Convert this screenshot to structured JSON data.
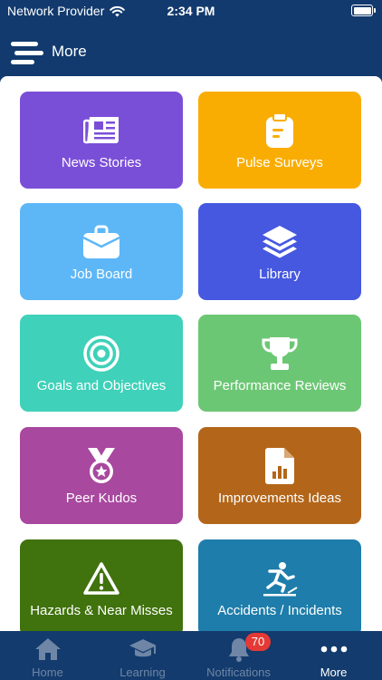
{
  "status_bar": {
    "carrier": "Network Provider",
    "time": "2:34 PM"
  },
  "header": {
    "title": "More"
  },
  "colors": {
    "app_bar": "#123a6e",
    "content_background": "#ffffff",
    "badge": "#e53935"
  },
  "tiles": [
    {
      "label": "News Stories",
      "icon": "newspaper-icon",
      "color": "#7a4fd8"
    },
    {
      "label": "Pulse Surveys",
      "icon": "clipboard-icon",
      "color": "#f9ad03"
    },
    {
      "label": "Job Board",
      "icon": "briefcase-icon",
      "color": "#5db7f7"
    },
    {
      "label": "Library",
      "icon": "layers-icon",
      "color": "#4658e0"
    },
    {
      "label": "Goals and Objectives",
      "icon": "target-icon",
      "color": "#3fd1b9"
    },
    {
      "label": "Performance Reviews",
      "icon": "trophy-icon",
      "color": "#6cc774"
    },
    {
      "label": "Peer Kudos",
      "icon": "medal-icon",
      "color": "#a8489f"
    },
    {
      "label": "Improvements Ideas",
      "icon": "chart-document-icon",
      "color": "#b3661a"
    },
    {
      "label": "Hazards & Near Misses",
      "icon": "warning-icon",
      "color": "#40720e"
    },
    {
      "label": "Accidents / Incidents",
      "icon": "slip-fall-icon",
      "color": "#1e7daa"
    }
  ],
  "tab_bar": {
    "tabs": [
      {
        "label": "Home",
        "icon": "home-icon",
        "active": false
      },
      {
        "label": "Learning",
        "icon": "graduation-cap-icon",
        "active": false
      },
      {
        "label": "Notifications",
        "icon": "bell-icon",
        "active": false,
        "badge": "70"
      },
      {
        "label": "More",
        "icon": "more-dots-icon",
        "active": true
      }
    ]
  }
}
